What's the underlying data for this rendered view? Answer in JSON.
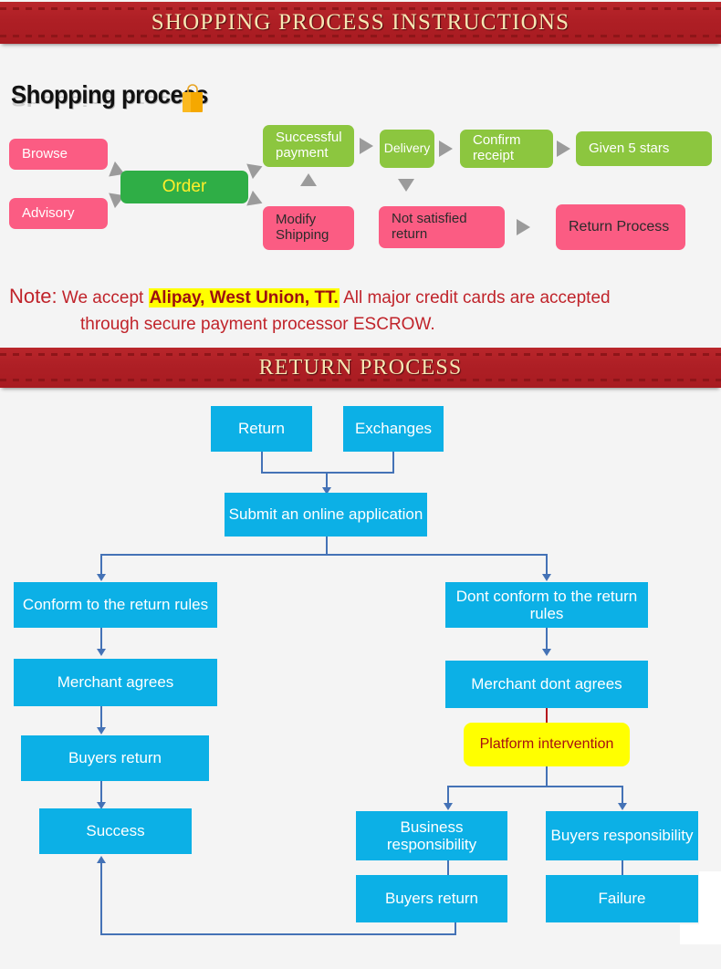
{
  "banners": {
    "top": "SHOPPING PROCESS INSTRUCTIONS",
    "return": "RETURN PROCESS"
  },
  "section_heading": {
    "title": "Shopping process",
    "icon": "shopping-bag-icon"
  },
  "colors": {
    "banner_red": "#ae1f25",
    "banner_gold": "#f7e7b4",
    "pink": "#fb5c83",
    "light_green": "#8cc63f",
    "order_green": "#2fae46",
    "order_text_yellow": "#ffef2b",
    "blue": "#0cb0e6",
    "yellow": "#ffff00",
    "connector_blue": "#4472b6",
    "note_red": "#c0232a",
    "arrow_grey": "#9b9b9b",
    "page_bg": "#f4f4f4"
  },
  "shopping_flow": {
    "nodes": [
      {
        "id": "browse",
        "label": "Browse",
        "style": "pink"
      },
      {
        "id": "advisory",
        "label": "Advisory",
        "style": "pink"
      },
      {
        "id": "order",
        "label": "Order",
        "style": "order-green"
      },
      {
        "id": "successful-payment",
        "label": "Successful payment",
        "style": "light-green"
      },
      {
        "id": "modify-shipping",
        "label": "Modify Shipping",
        "style": "pink-dark-text"
      },
      {
        "id": "delivery",
        "label": "Delivery",
        "style": "light-green"
      },
      {
        "id": "confirm-receipt",
        "label": "Confirm receipt",
        "style": "light-green"
      },
      {
        "id": "given-5-stars",
        "label": "Given 5 stars",
        "style": "light-green"
      },
      {
        "id": "not-satisfied-return",
        "label": "Not satisfied return",
        "style": "pink-dark-text"
      },
      {
        "id": "return-process",
        "label": "Return Process",
        "style": "pink-dark-text"
      }
    ]
  },
  "note": {
    "label": "Note:",
    "text_before": "We accept",
    "highlight": "Alipay, West Union, TT.",
    "text_after": "All major credit cards are accepted",
    "line2": "through secure payment processor ESCROW."
  },
  "return_flow": {
    "nodes": [
      {
        "id": "return",
        "label": "Return"
      },
      {
        "id": "exchanges",
        "label": "Exchanges"
      },
      {
        "id": "submit-online-application",
        "label": "Submit an online application"
      },
      {
        "id": "conform-return-rules",
        "label": "Conform to the return rules"
      },
      {
        "id": "dont-conform-return-rules",
        "label": "Dont conform to the return rules"
      },
      {
        "id": "merchant-agrees",
        "label": "Merchant agrees"
      },
      {
        "id": "merchant-dont-agrees",
        "label": "Merchant dont agrees"
      },
      {
        "id": "buyers-return-left",
        "label": "Buyers return"
      },
      {
        "id": "platform-intervention",
        "label": "Platform intervention"
      },
      {
        "id": "success",
        "label": "Success"
      },
      {
        "id": "business-responsibility",
        "label": "Business responsibility"
      },
      {
        "id": "buyers-responsibility",
        "label": "Buyers responsibility"
      },
      {
        "id": "buyers-return-right",
        "label": "Buyers return"
      },
      {
        "id": "failure",
        "label": "Failure"
      }
    ]
  }
}
